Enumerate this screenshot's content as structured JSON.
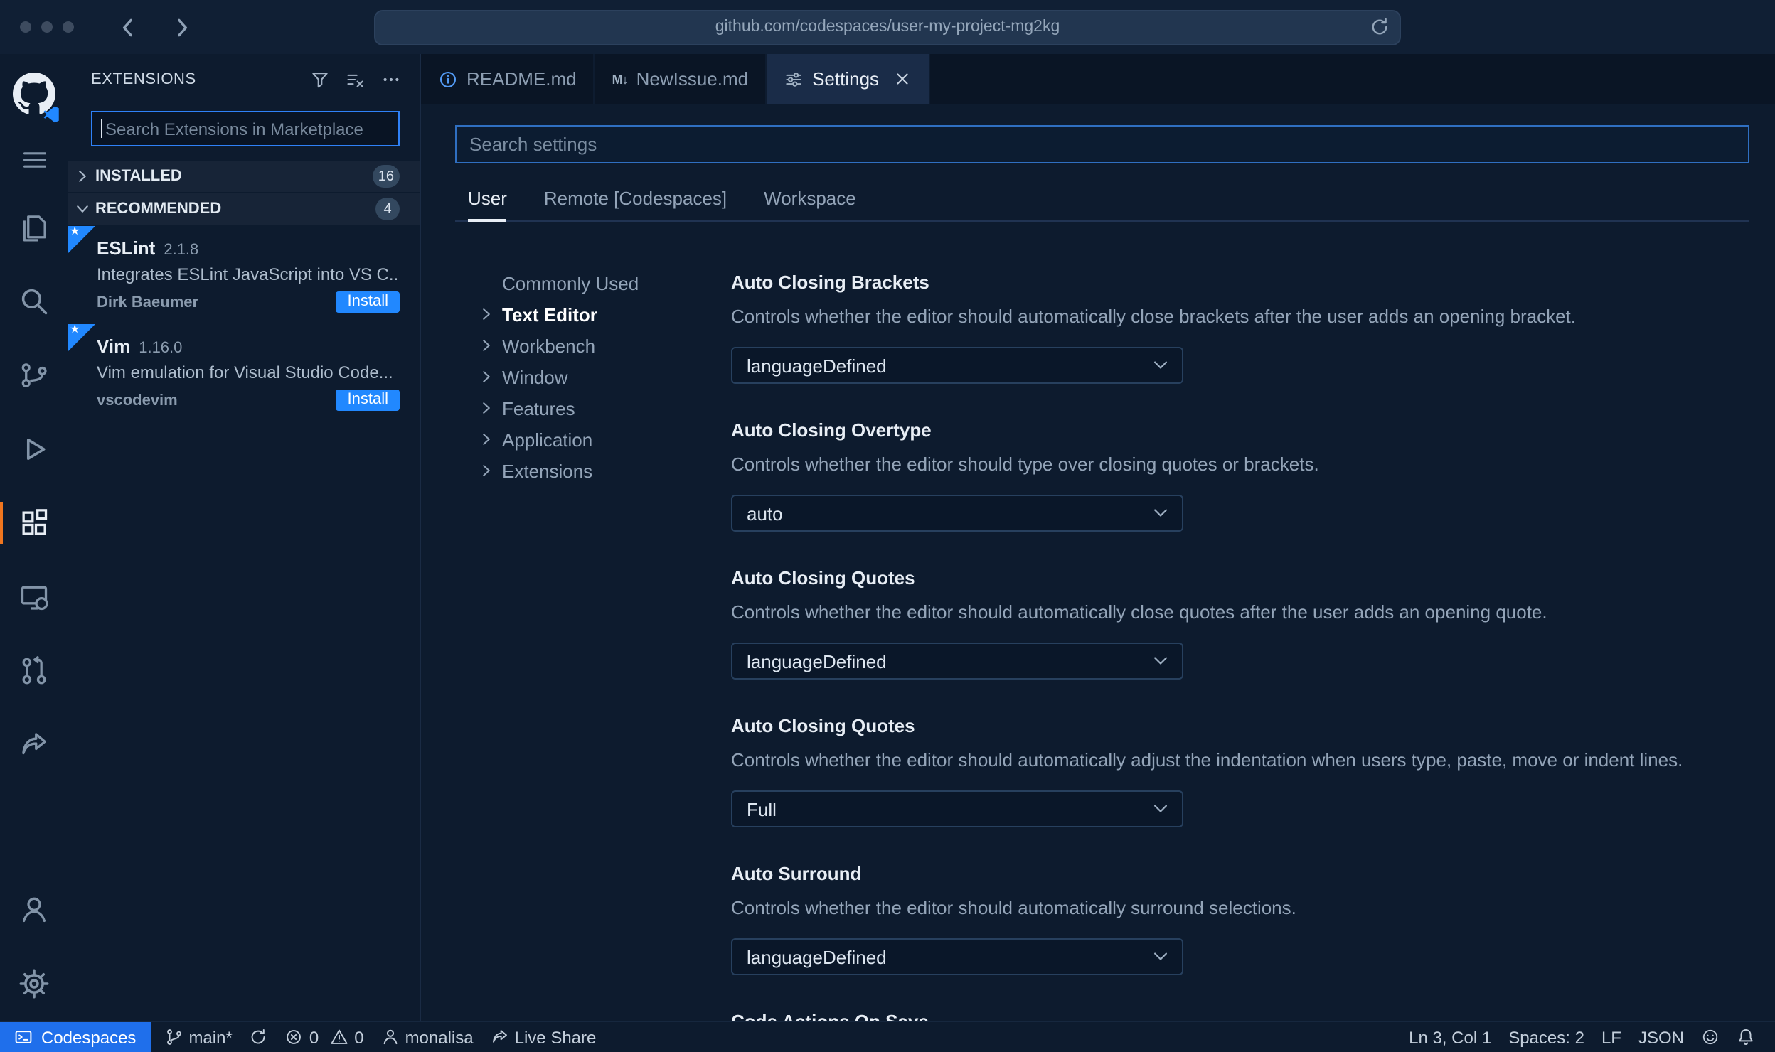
{
  "colors": {
    "background": "#0d1b2e",
    "accent_blue": "#2188ff",
    "status_blue": "#1f6feb",
    "activity_accent_orange": "#f0761f",
    "focus_border": "#2f81f7"
  },
  "browser": {
    "url": "github.com/codespaces/user-my-project-mg2kg"
  },
  "activity_bar": {
    "icons": [
      "github-logo",
      "menu",
      "explorer",
      "search",
      "source-control",
      "run-and-debug",
      "extensions",
      "remote-explorer",
      "pull-requests",
      "live-share",
      "account",
      "settings-gear"
    ],
    "active": "extensions"
  },
  "sidebar": {
    "title": "EXTENSIONS",
    "header_icons": [
      "filter",
      "clear-search-results",
      "more-actions"
    ],
    "search_placeholder": "Search Extensions in Marketplace",
    "sections": [
      {
        "label": "INSTALLED",
        "count": "16",
        "state": "collapsed"
      },
      {
        "label": "RECOMMENDED",
        "count": "4",
        "state": "expanded"
      }
    ],
    "extensions": [
      {
        "name": "ESLint",
        "version": "2.1.8",
        "description": "Integrates ESLint JavaScript into VS C...",
        "publisher": "Dirk Baeumer",
        "action": "Install"
      },
      {
        "name": "Vim",
        "version": "1.16.0",
        "description": "Vim emulation for Visual Studio Code...",
        "publisher": "vscodevim",
        "action": "Install"
      }
    ]
  },
  "editor": {
    "tabs": [
      {
        "label": "README.md",
        "icon": "info"
      },
      {
        "label": "NewIssue.md",
        "icon": "markdown",
        "icon_text": "M↓"
      },
      {
        "label": "Settings",
        "icon": "settings-editor",
        "active": true
      }
    ]
  },
  "settings": {
    "search_placeholder": "Search settings",
    "scope_tabs": [
      {
        "label": "User",
        "active": true
      },
      {
        "label": "Remote [Codespaces]"
      },
      {
        "label": "Workspace"
      }
    ],
    "toc": [
      {
        "label": "Commonly Used"
      },
      {
        "label": "Text Editor",
        "active": true
      },
      {
        "label": "Workbench"
      },
      {
        "label": "Window"
      },
      {
        "label": "Features"
      },
      {
        "label": "Application"
      },
      {
        "label": "Extensions"
      }
    ],
    "items": [
      {
        "title": "Auto Closing Brackets",
        "description": "Controls whether the editor should automatically close brackets after the user adds an opening bracket.",
        "value": "languageDefined"
      },
      {
        "title": "Auto Closing Overtype",
        "description": "Controls whether the editor should type over closing quotes or brackets.",
        "value": "auto"
      },
      {
        "title": "Auto Closing Quotes",
        "description": "Controls whether the editor should automatically close quotes after the user adds an opening quote.",
        "value": "languageDefined"
      },
      {
        "title": "Auto Closing Quotes",
        "description": "Controls whether the editor should automatically adjust the indentation when users type, paste, move or indent lines.",
        "value": "Full"
      },
      {
        "title": "Auto Surround",
        "description": "Controls whether the editor should automatically surround selections.",
        "value": "languageDefined"
      },
      {
        "title": "Code Actions On Save"
      }
    ]
  },
  "status_bar": {
    "icons": [
      "codespaces",
      "git-branch",
      "sync",
      "error",
      "warning",
      "account",
      "live-share",
      "feedback",
      "bell"
    ],
    "codespaces": "Codespaces",
    "branch": "main*",
    "errors": "0",
    "warnings": "0",
    "user": "monalisa",
    "live_share": "Live Share",
    "line_col": "Ln 3, Col 1",
    "spaces": "Spaces: 2",
    "eol": "LF",
    "language": "JSON"
  }
}
